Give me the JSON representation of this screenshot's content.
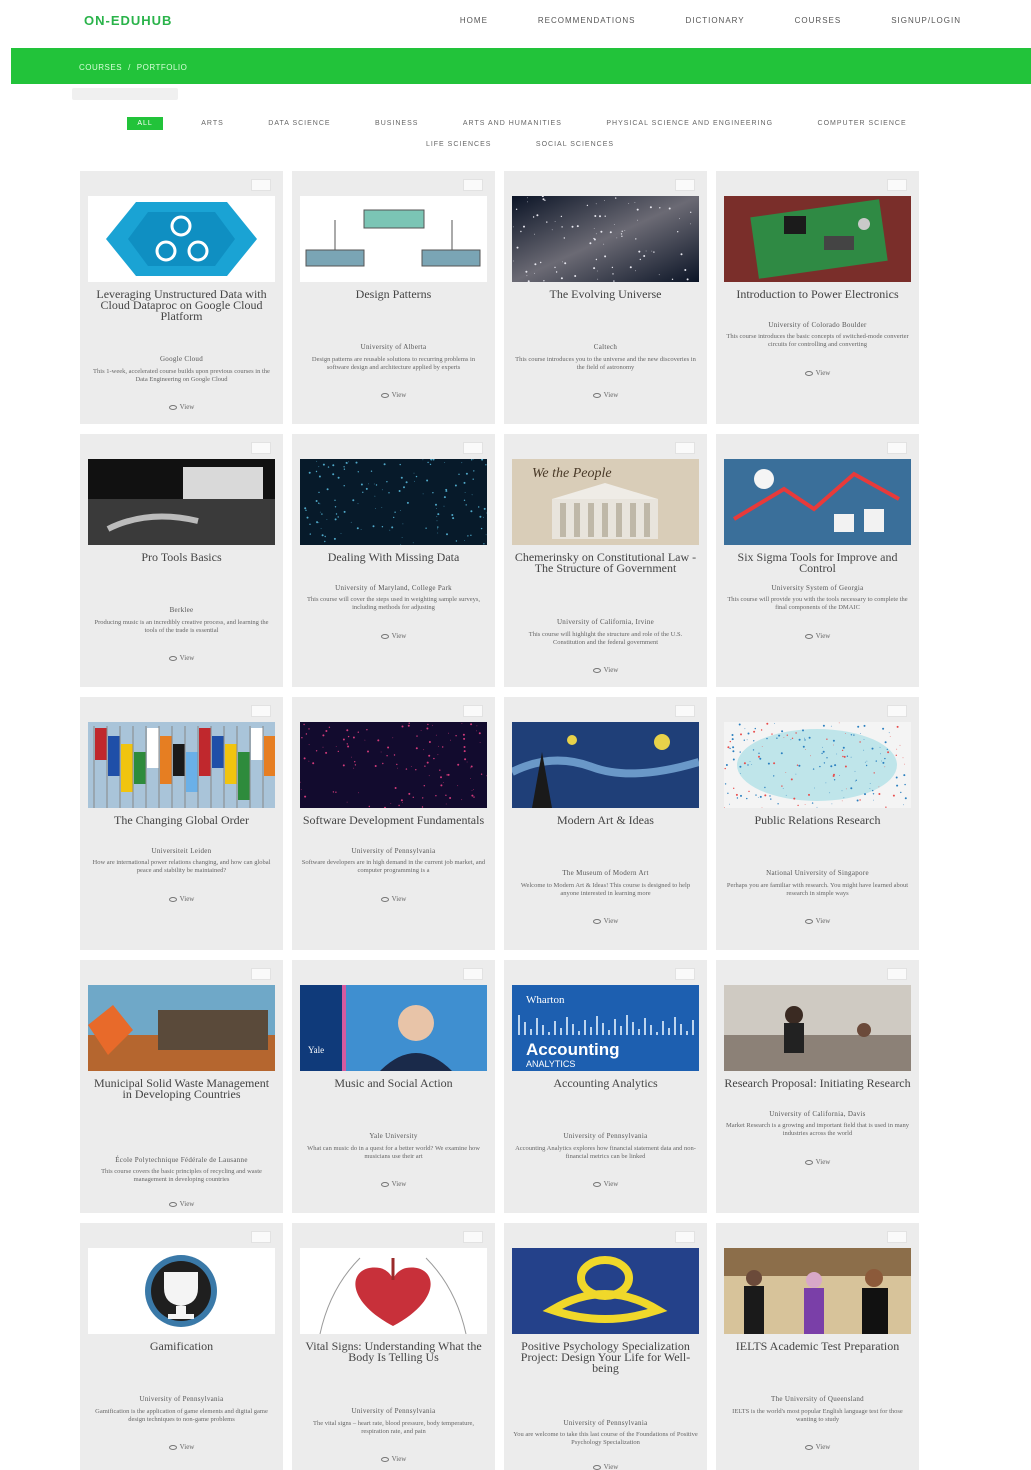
{
  "brand": "ON-EDUHUB",
  "nav": [
    "HOME",
    "RECOMMENDATIONS",
    "DICTIONARY",
    "COURSES",
    "SIGNUP/LOGIN"
  ],
  "breadcrumb": [
    "COURSES",
    "/",
    "PORTFOLIO"
  ],
  "filters": [
    "ALL",
    "ARTS",
    "DATA SCIENCE",
    "BUSINESS",
    "ARTS AND HUMANITIES",
    "PHYSICAL SCIENCE AND ENGINEERING",
    "COMPUTER SCIENCE",
    "LIFE SCIENCES",
    "SOCIAL SCIENCES"
  ],
  "active_filter": "ALL",
  "view_label": "View",
  "cards": [
    {
      "title": "Leveraging Unstructured Data with Cloud Dataproc on Google Cloud Platform",
      "org": "Google Cloud",
      "desc": "This 1-week, accelerated course builds upon previous courses in the Data Engineering on Google Cloud",
      "thumb": "dataproc",
      "tclass": "t3"
    },
    {
      "title": "Design Patterns",
      "org": "University of Alberta",
      "desc": "Design patterns are reusable solutions to recurring problems in software design and architecture applied by experts",
      "thumb": "uml",
      "tclass": "t1"
    },
    {
      "title": "The Evolving Universe",
      "org": "Caltech",
      "desc": "This course introduces you to the universe and the new discoveries in the field of astronomy",
      "thumb": "galaxy",
      "tclass": "t1"
    },
    {
      "title": "Introduction to Power Electronics",
      "org": "University of Colorado Boulder",
      "desc": "This course introduces the basic concepts of switched-mode converter circuits for controlling and converting",
      "thumb": "pcb",
      "tclass": "t2b"
    },
    {
      "title": "Pro Tools Basics",
      "org": "Berklee",
      "desc": "Producing music is an incredibly creative process, and learning the tools of the trade is essential",
      "thumb": "studio",
      "tclass": "t1"
    },
    {
      "title": "Dealing With Missing Data",
      "org": "University of Maryland, College Park",
      "desc": "This course will cover the steps used in weighting sample surveys, including methods for adjusting",
      "thumb": "particles",
      "tclass": "t2"
    },
    {
      "title": "Chemerinsky on Constitutional Law - The Structure of Government",
      "org": "University of California, Irvine",
      "desc": "This course will highlight the structure and role of the U.S. Constitution and the federal government",
      "thumb": "court",
      "tclass": "t3"
    },
    {
      "title": "Six Sigma Tools for Improve and Control",
      "org": "University System of Georgia",
      "desc": "This course will provide you with the tools necessary to complete the final components of the DMAIC",
      "thumb": "sixsigma",
      "tclass": "t2"
    },
    {
      "title": "The Changing Global Order",
      "org": "Universiteit Leiden",
      "desc": "How are international power relations changing, and how can global peace and stability be maintained?",
      "thumb": "flags",
      "tclass": "t2"
    },
    {
      "title": "Software Development Fundamentals",
      "org": "University of Pennsylvania",
      "desc": "Software developers are in high demand in the current job market, and computer programming is a",
      "thumb": "code",
      "tclass": "t2"
    },
    {
      "title": "Modern Art & Ideas",
      "org": "The Museum of Modern Art",
      "desc": "Welcome to Modern Art & Ideas! This course is designed to help anyone interested in learning more",
      "thumb": "starry",
      "tclass": "t1"
    },
    {
      "title": "Public Relations Research",
      "org": "National University of Singapore",
      "desc": "Perhaps you are familiar with research. You might have learned about research in simple ways",
      "thumb": "map",
      "tclass": "t1"
    },
    {
      "title": "Municipal Solid Waste Management in Developing Countries",
      "org": "École Polytechnique Fédérale de Lausanne",
      "desc": "This course covers the basic principles of recycling and waste management in developing countries",
      "thumb": "waste",
      "tclass": "t4"
    },
    {
      "title": "Music and Social Action",
      "org": "Yale University",
      "desc": "What can music do in a quest for a better world? We examine how musicians use their art",
      "thumb": "yale",
      "tclass": "t1"
    },
    {
      "title": "Accounting Analytics",
      "org": "University of Pennsylvania",
      "desc": "Accounting Analytics explores how financial statement data and non-financial metrics can be linked",
      "thumb": "wharton",
      "tclass": "t1"
    },
    {
      "title": "Research Proposal: Initiating Research",
      "org": "University of California, Davis",
      "desc": "Market Research is a growing and important field that is used in many industries across the world",
      "thumb": "research",
      "tclass": "t2"
    },
    {
      "title": "Gamification",
      "org": "University of Pennsylvania",
      "desc": "Gamification is the application of game elements and digital game design techniques to non-game problems",
      "thumb": "trophy",
      "tclass": "t1"
    },
    {
      "title": "Vital Signs: Understanding What the Body Is Telling Us",
      "org": "University of Pennsylvania",
      "desc": "The vital signs – heart rate, blood pressure, body temperature, respiration rate, and pain",
      "thumb": "heart",
      "tclass": "t3"
    },
    {
      "title": "Positive Psychology Specialization Project: Design Your Life for Well-being",
      "org": "University of Pennsylvania",
      "desc": "You are welcome to take this last course of the Foundations of Positive Psychology Specialization",
      "thumb": "knot",
      "tclass": "t4"
    },
    {
      "title": "IELTS Academic Test Preparation",
      "org": "The University of Queensland",
      "desc": "IELTS is the world's most popular English language test for those wanting to study",
      "thumb": "grads",
      "tclass": "t1"
    }
  ],
  "colors": {
    "brand_green": "#22c33a",
    "card_bg": "#ececec"
  }
}
